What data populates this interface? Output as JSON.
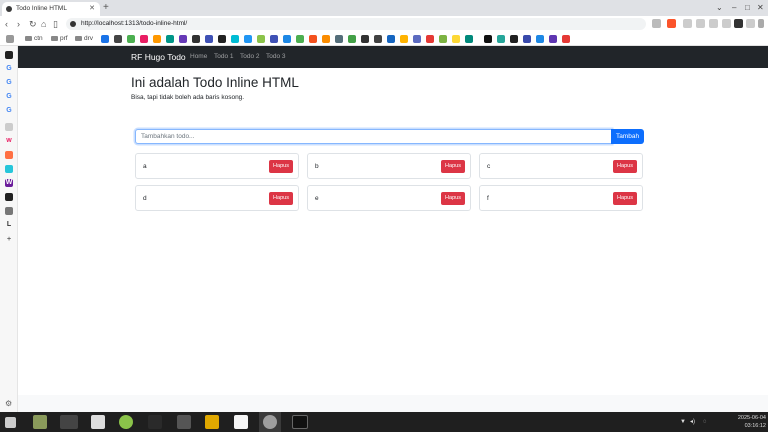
{
  "browser": {
    "tab_title": "Todo Inline HTML",
    "url": "http://localhost:1313/todo-inline-html/",
    "bookmarks": [
      "ctn",
      "prf",
      "drv"
    ]
  },
  "site": {
    "brand": "RF Hugo Todo",
    "nav": [
      "Home",
      "Todo 1",
      "Todo 2",
      "Todo 3"
    ]
  },
  "page": {
    "title": "Ini adalah Todo Inline HTML",
    "subtitle": "Bisa, tapi tidak boleh ada baris kosong."
  },
  "todo_form": {
    "placeholder": "Tambahkan todo...",
    "add_label": "Tambah"
  },
  "todos": [
    {
      "text": "a",
      "delete_label": "Hapus"
    },
    {
      "text": "b",
      "delete_label": "Hapus"
    },
    {
      "text": "c",
      "delete_label": "Hapus"
    },
    {
      "text": "d",
      "delete_label": "Hapus"
    },
    {
      "text": "e",
      "delete_label": "Hapus"
    },
    {
      "text": "f",
      "delete_label": "Hapus"
    }
  ],
  "taskbar": {
    "date": "2025-06-04",
    "time": "03:16:12"
  },
  "colors": {
    "primary": "#0d6efd",
    "danger": "#dc3545",
    "navbar": "#212529"
  }
}
